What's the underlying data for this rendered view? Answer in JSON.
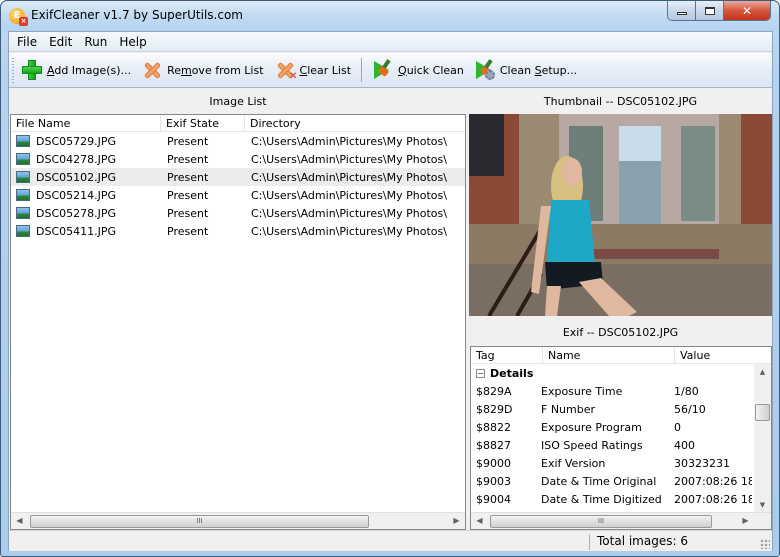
{
  "window": {
    "title": "ExifCleaner v1.7 by SuperUtils.com",
    "app_icon_letter": "E"
  },
  "menu": [
    "File",
    "Edit",
    "Run",
    "Help"
  ],
  "toolbar": {
    "add_images": {
      "pre": "",
      "ul": "A",
      "post": "dd Image(s)..."
    },
    "remove_from_list": {
      "pre": "Re",
      "ul": "m",
      "post": "ove from List"
    },
    "clear_list": {
      "pre": "",
      "ul": "C",
      "post": "lear List"
    },
    "quick_clean": {
      "pre": "",
      "ul": "Q",
      "post": "uick Clean"
    },
    "clean_setup": {
      "pre": "Clean ",
      "ul": "S",
      "post": "etup..."
    }
  },
  "image_list": {
    "title": "Image List",
    "columns": [
      "File Name",
      "Exif State",
      "Directory"
    ],
    "rows": [
      {
        "file": "DSC05729.JPG",
        "state": "Present",
        "dir": "C:\\Users\\Admin\\Pictures\\My Photos\\",
        "selected": false
      },
      {
        "file": "DSC04278.JPG",
        "state": "Present",
        "dir": "C:\\Users\\Admin\\Pictures\\My Photos\\",
        "selected": false
      },
      {
        "file": "DSC05102.JPG",
        "state": "Present",
        "dir": "C:\\Users\\Admin\\Pictures\\My Photos\\",
        "selected": true
      },
      {
        "file": "DSC05214.JPG",
        "state": "Present",
        "dir": "C:\\Users\\Admin\\Pictures\\My Photos\\",
        "selected": false
      },
      {
        "file": "DSC05278.JPG",
        "state": "Present",
        "dir": "C:\\Users\\Admin\\Pictures\\My Photos\\",
        "selected": false
      },
      {
        "file": "DSC05411.JPG",
        "state": "Present",
        "dir": "C:\\Users\\Admin\\Pictures\\My Photos\\",
        "selected": false
      }
    ]
  },
  "thumbnail": {
    "title": "Thumbnail -- DSC05102.JPG"
  },
  "exif": {
    "title": "Exif -- DSC05102.JPG",
    "columns": [
      "Tag",
      "Name",
      "Value"
    ],
    "group": {
      "toggle": "−",
      "label": "Details"
    },
    "rows": [
      {
        "tag": "$829A",
        "name": "Exposure Time",
        "value": "1/80"
      },
      {
        "tag": "$829D",
        "name": "F Number",
        "value": "56/10"
      },
      {
        "tag": "$8822",
        "name": "Exposure Program",
        "value": "0"
      },
      {
        "tag": "$8827",
        "name": "ISO Speed Ratings",
        "value": "400"
      },
      {
        "tag": "$9000",
        "name": "Exif Version",
        "value": "30323231"
      },
      {
        "tag": "$9003",
        "name": "Date & Time Original",
        "value": "2007:08:26 18:"
      },
      {
        "tag": "$9004",
        "name": "Date & Time Digitized",
        "value": "2007:08:26 18:"
      }
    ]
  },
  "scrollbar": {
    "thumb_grip": "III",
    "left_arrow": "◀",
    "right_arrow": "▶",
    "up_arrow": "▲",
    "down_arrow": "▼"
  },
  "status": {
    "total_images": "Total images: 6"
  }
}
